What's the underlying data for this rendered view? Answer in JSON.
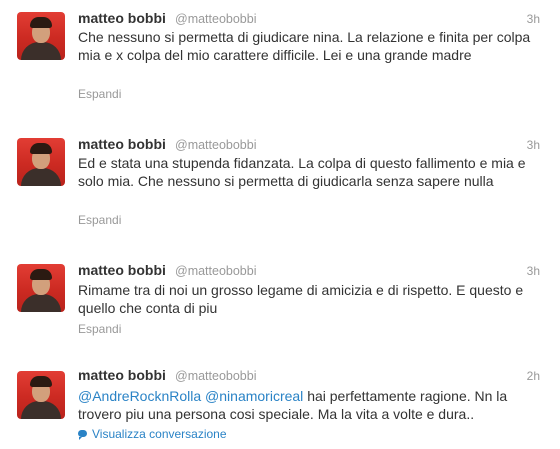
{
  "tweets": [
    {
      "name": "matteo bobbi",
      "handle": "@matteobobbi",
      "time": "3h",
      "text": "Che nessuno si permetta di giudicare nina. La relazione e finita per colpa mia e x colpa del mio carattere difficile. Lei e una grande madre",
      "action": "Espandi"
    },
    {
      "name": "matteo bobbi",
      "handle": "@matteobobbi",
      "time": "3h",
      "text": "Ed e stata una stupenda fidanzata. La colpa di questo fallimento e mia e solo mia. Che nessuno si permetta di giudicarla senza sapere nulla",
      "action": "Espandi"
    },
    {
      "name": "matteo bobbi",
      "handle": "@matteobobbi",
      "time": "3h",
      "text": "Rimame tra di noi un grosso legame di amicizia e di rispetto. E questo e quello che conta di piu",
      "action": "Espandi"
    },
    {
      "name": "matteo bobbi",
      "handle": "@matteobobbi",
      "time": "2h",
      "mention1": "@AndreRocknRolla",
      "mention2": "@ninamoricreal",
      "text": "hai perfettamente ragione. Nn la trovero piu una persona cosi speciale. Ma la vita a volte e dura..",
      "action": "Visualizza conversazione"
    }
  ],
  "colors": {
    "link": "#2a83c6",
    "muted": "#999999",
    "text": "#333333",
    "avatar_bg": "#d8342c"
  },
  "icons": {
    "conversation": "speech-bubble-icon"
  }
}
